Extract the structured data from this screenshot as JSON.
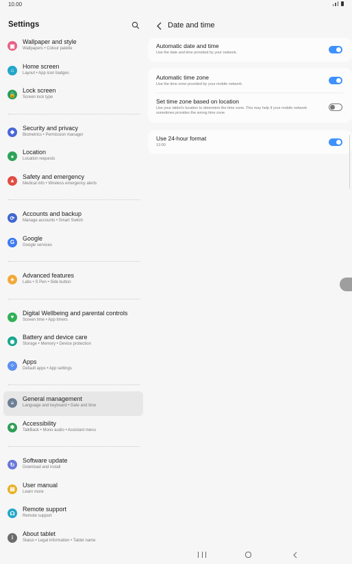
{
  "status_bar": {
    "time": "10.00"
  },
  "left": {
    "title": "Settings",
    "items": [
      {
        "name": "wallpaper",
        "title": "Wallpaper and style",
        "sub": "Wallpapers  •  Colour palette",
        "icon": "wallpaper-icon",
        "color": "#e75f84",
        "glyph": "▣"
      },
      {
        "name": "home-screen",
        "title": "Home screen",
        "sub": "Layout  •  App icon badges",
        "icon": "home-icon",
        "color": "#23a6c9",
        "glyph": "⌂"
      },
      {
        "name": "lock-screen",
        "title": "Lock screen",
        "sub": "Screen lock type",
        "icon": "lock-icon",
        "color": "#2a9e5a",
        "glyph": "🔒"
      },
      {
        "sep": true
      },
      {
        "name": "security",
        "title": "Security and privacy",
        "sub": "Biometrics  •  Permission manager",
        "icon": "shield-icon",
        "color": "#4a67d6",
        "glyph": "◆"
      },
      {
        "name": "location",
        "title": "Location",
        "sub": "Location requests",
        "icon": "location-pin-icon",
        "color": "#2ea35b",
        "glyph": "●"
      },
      {
        "name": "safety",
        "title": "Safety and emergency",
        "sub": "Medical info  •  Wireless emergency alerts",
        "icon": "emergency-icon",
        "color": "#e04d43",
        "glyph": "▲"
      },
      {
        "sep": true
      },
      {
        "name": "accounts",
        "title": "Accounts and backup",
        "sub": "Manage accounts  •  Smart Switch",
        "icon": "sync-icon",
        "color": "#3f66d1",
        "glyph": "⟳"
      },
      {
        "name": "google",
        "title": "Google",
        "sub": "Google services",
        "icon": "google-icon",
        "color": "#3d7bf4",
        "glyph": "G"
      },
      {
        "sep": true
      },
      {
        "name": "advanced",
        "title": "Advanced features",
        "sub": "Labs  •  S Pen  •  Side button",
        "icon": "star-gear-icon",
        "color": "#f2a93b",
        "glyph": "✦"
      },
      {
        "sep": true
      },
      {
        "name": "wellbeing",
        "title": "Digital Wellbeing and parental controls",
        "sub": "Screen time  •  App timers",
        "icon": "heart-icon",
        "color": "#31b057",
        "glyph": "♥"
      },
      {
        "name": "battery",
        "title": "Battery and device care",
        "sub": "Storage  •  Memory  •  Device protection",
        "icon": "device-care-icon",
        "color": "#1aa68f",
        "glyph": "◉"
      },
      {
        "name": "apps",
        "title": "Apps",
        "sub": "Default apps  •  App settings",
        "icon": "apps-grid-icon",
        "color": "#5d8ff2",
        "glyph": "⁘"
      },
      {
        "sep": true
      },
      {
        "name": "general",
        "title": "General management",
        "sub": "Language and keyboard  •  Date and time",
        "icon": "sliders-icon",
        "color": "#6d7f95",
        "glyph": "≡",
        "selected": true
      },
      {
        "name": "accessibility",
        "title": "Accessibility",
        "sub": "TalkBack  •  Mono audio  •  Assistant menu",
        "icon": "accessibility-icon",
        "color": "#2e9e55",
        "glyph": "✱"
      },
      {
        "sep": true
      },
      {
        "name": "software-update",
        "title": "Software update",
        "sub": "Download and install",
        "icon": "update-icon",
        "color": "#6b78d8",
        "glyph": "↻"
      },
      {
        "name": "user-manual",
        "title": "User manual",
        "sub": "Learn more",
        "icon": "manual-icon",
        "color": "#e8b021",
        "glyph": "▤"
      },
      {
        "name": "remote-support",
        "title": "Remote support",
        "sub": "Remote support",
        "icon": "headset-icon",
        "color": "#23a7c9",
        "glyph": "☊"
      },
      {
        "name": "about",
        "title": "About tablet",
        "sub": "Status  •  Legal information  •  Tablet name",
        "icon": "info-icon",
        "color": "#6c6c6c",
        "glyph": "i"
      }
    ]
  },
  "right": {
    "title": "Date and time",
    "auto_date": {
      "title": "Automatic date and time",
      "sub": "Use the date and time provided by your network."
    },
    "auto_zone": {
      "title": "Automatic time zone",
      "sub": "Use the time zone provided by your mobile network."
    },
    "location_zone": {
      "title": "Set time zone based on location",
      "sub": "Use your tablet's location to determine the time zone. This may help if your mobile network sometimes provides the wrong time zone."
    },
    "format24": {
      "title": "Use 24-hour format",
      "sub": "13:00"
    }
  },
  "colors": {
    "accent": "#3e91ff",
    "background": "#f6f6f6",
    "card": "#fcfcfc",
    "selected": "#e7e7e7"
  }
}
